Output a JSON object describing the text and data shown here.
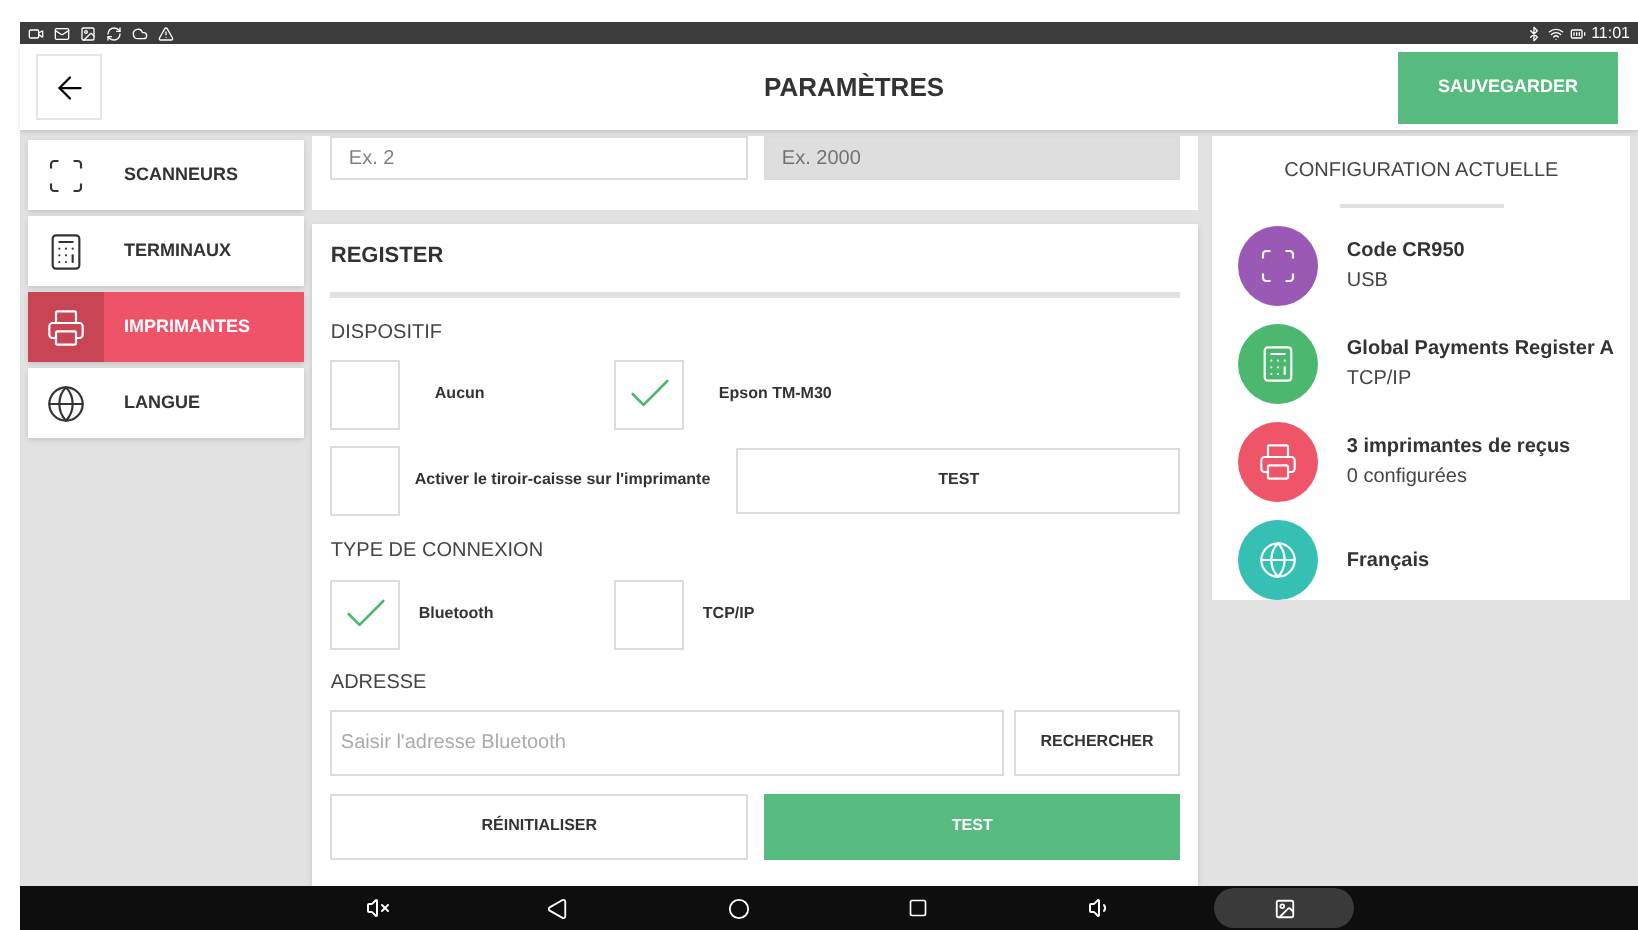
{
  "status_bar": {
    "time": "11:01"
  },
  "header": {
    "title": "PARAMÈTRES",
    "save_button": "SAUVEGARDER"
  },
  "sidebar": {
    "items": [
      {
        "label": "SCANNEURS",
        "kind": "scanner",
        "selected": false
      },
      {
        "label": "TERMINAUX",
        "kind": "register",
        "selected": false
      },
      {
        "label": "IMPRIMANTES",
        "kind": "printer",
        "selected": true
      },
      {
        "label": "LANGUE",
        "kind": "globe",
        "selected": false
      }
    ]
  },
  "top_fields": [
    {
      "placeholder": "Ex. 2",
      "disabled": false
    },
    {
      "placeholder": "Ex. 2000",
      "disabled": true
    }
  ],
  "register": {
    "title": "REGISTER",
    "device_label": "DISPOSITIF",
    "devices": [
      {
        "label": "Aucun",
        "checked": false
      },
      {
        "label": "Epson TM-M30",
        "checked": true
      }
    ],
    "drawer": {
      "label": "Activer le tiroir-caisse sur l'imprimante",
      "checked": false
    },
    "drawer_test_button": "TEST",
    "connection_label": "TYPE DE CONNEXION",
    "connections": [
      {
        "label": "Bluetooth",
        "checked": true
      },
      {
        "label": "TCP/IP",
        "checked": false
      }
    ],
    "address_label": "ADRESSE",
    "address_field": {
      "placeholder": "Saisir l'adresse Bluetooth"
    },
    "search_button": "RECHERCHER",
    "reset_button": "RÉINITIALISER",
    "test_button": "TEST"
  },
  "current_config": {
    "title": "CONFIGURATION ACTUELLE",
    "items": [
      {
        "kind": "scanner",
        "color": "#9b59b6",
        "name": "Code CR950",
        "detail": "USB"
      },
      {
        "kind": "register",
        "color": "#4cb86f",
        "name": "Global Payments Register A",
        "detail": "TCP/IP"
      },
      {
        "kind": "printer",
        "color": "#ee5569",
        "name": "3 imprimantes de reçus",
        "detail": "0 configurées"
      },
      {
        "kind": "globe",
        "color": "#36bfb3",
        "name": "Français"
      }
    ]
  }
}
